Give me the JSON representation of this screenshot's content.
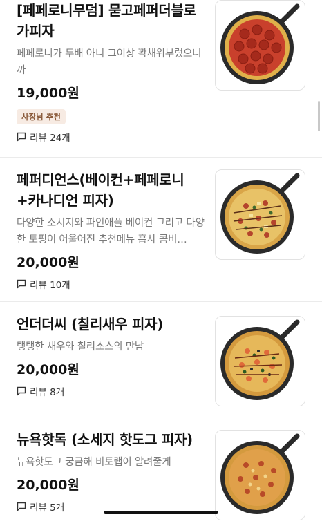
{
  "menu": [
    {
      "title": "[페페로니무덤] 묻고페퍼더블로가피자",
      "description": "페페로니가 두배 아니 그이상 꽉채워부렀으니까",
      "price": "19,000원",
      "badge": "사장님 추천",
      "review": "리뷰 24개",
      "topping": "pepperoni"
    },
    {
      "title": "페퍼디언스(베이컨+페페로니+카나디언 피자)",
      "description": "다양한 소시지와 파인애플 베이컨 그리고 다양한 토핑이 어울어진 추천메뉴 흡사 콤비…",
      "price": "20,000원",
      "review": "리뷰 10개",
      "topping": "mixed"
    },
    {
      "title": "언더더씨 (칠리새우 피자)",
      "description": "탱탱한 새우와 칠리소스의 만남",
      "price": "20,000원",
      "review": "리뷰 8개",
      "topping": "shrimp"
    },
    {
      "title": "뉴욕핫독 (소세지 핫도그 피자)",
      "description": "뉴욕핫도그 궁금해 비토랩이 알려줄게",
      "price": "20,000원",
      "review": "리뷰 5개",
      "topping": "hotdog"
    }
  ],
  "colors": {
    "badge_bg": "#f7ebe3",
    "badge_text": "#8a5a3a",
    "pan": "#2a2a2a"
  }
}
